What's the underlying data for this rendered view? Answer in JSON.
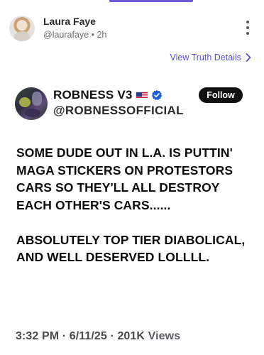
{
  "post": {
    "author_name": "Laura Faye",
    "author_handle": "@laurafaye",
    "separator": "•",
    "time_ago": "2h"
  },
  "truth_details": {
    "label": "View Truth Details"
  },
  "quoted": {
    "display_name": "ROBNESS V3",
    "handle": "@ROBNESSOFFICIAL",
    "follow_label": "Follow",
    "paragraphs": [
      "SOME DUDE OUT IN L.A. IS PUTTIN' MAGA STICKERS ON PROTESTORS CARS SO THEY'LL ALL DESTROY EACH OTHER'S CARS......",
      "ABSOLUTELY TOP TIER DIABOLICAL, AND WELL DESERVED LOLLLL."
    ],
    "time": "3:32 PM",
    "dot1": "·",
    "date": "6/11/25",
    "dot2": "·",
    "views_count": "201K",
    "views_label": "Views"
  },
  "colors": {
    "accent": "#5b4fd1",
    "verified": "#1d5fd6",
    "follow_bg": "#111111"
  },
  "icons": [
    "more-vertical-icon",
    "chevron-right-icon",
    "us-flag-icon",
    "verified-badge-icon"
  ]
}
